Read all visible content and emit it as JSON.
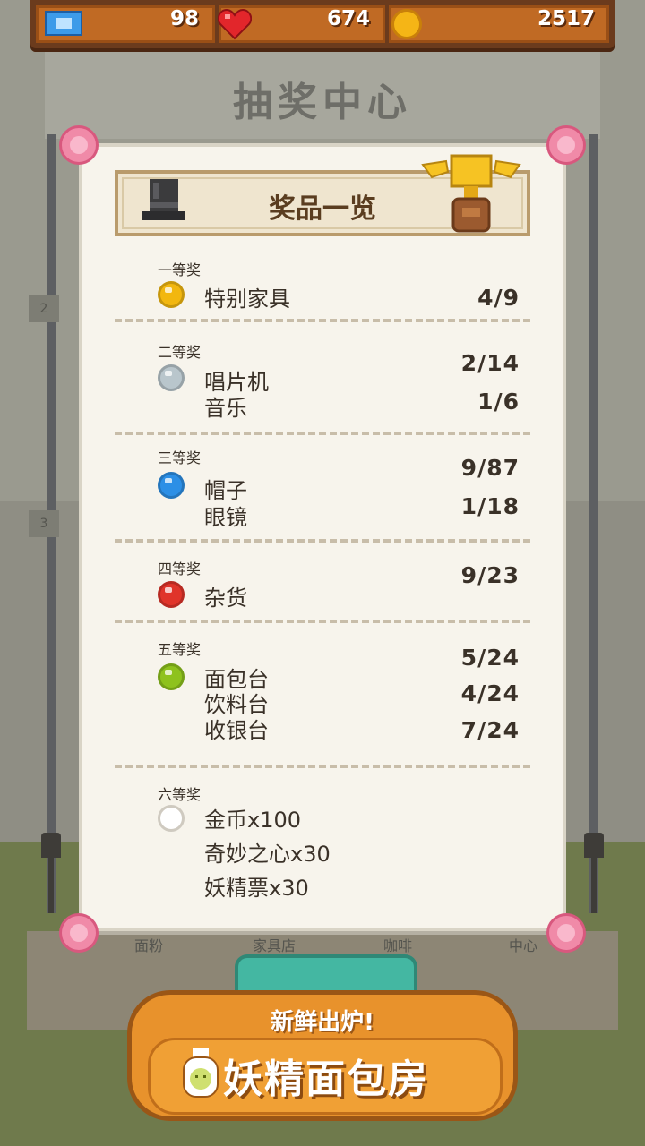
{
  "hud": {
    "tickets": "98",
    "hearts": "674",
    "coins": "2517"
  },
  "stall": {
    "title": "抽奖中心",
    "side_tab_1": "2",
    "side_tab_2": "3",
    "bottom_labels": [
      "面粉",
      "家具店",
      "咖啡",
      "中心"
    ]
  },
  "prize_list": {
    "title": "奖品一览",
    "tiers": [
      {
        "label": "一等奖",
        "gem_color": "#f2b70f",
        "items": [
          "特别家具"
        ],
        "counts": [
          "4/9"
        ]
      },
      {
        "label": "二等奖",
        "gem_color": "#b9c6cc",
        "items": [
          "唱片机",
          "音乐"
        ],
        "counts": [
          "2/14",
          "1/6"
        ]
      },
      {
        "label": "三等奖",
        "gem_color": "#2c8fe6",
        "items": [
          "帽子",
          "眼镜"
        ],
        "counts": [
          "9/87",
          "1/18"
        ]
      },
      {
        "label": "四等奖",
        "gem_color": "#e0342a",
        "items": [
          "杂货"
        ],
        "counts": [
          "9/23"
        ]
      },
      {
        "label": "五等奖",
        "gem_color": "#8ec21d",
        "items": [
          "面包台",
          "饮料台",
          "收银台"
        ],
        "counts": [
          "5/24",
          "4/24",
          "7/24"
        ]
      },
      {
        "label": "六等奖",
        "gem_color": "#ffffff",
        "items": [
          "金币x100",
          "奇妙之心x30",
          "妖精票x30"
        ],
        "counts": []
      }
    ]
  },
  "ad": {
    "subtitle": "新鲜出炉!",
    "title": "妖精面包房"
  },
  "colors": {
    "hud_bg": "#6b3b1d",
    "hud_slot": "#c06a24",
    "card_bg": "#f7f4ec",
    "ad_orange": "#e8922c"
  },
  "icons": {
    "ticket": "ticket-icon",
    "heart": "heart-icon",
    "coin": "coin-icon",
    "hat": "top-hat-icon",
    "trophy": "trophy-icon",
    "rose": "rose-icon",
    "jar": "bread-jar-icon"
  }
}
